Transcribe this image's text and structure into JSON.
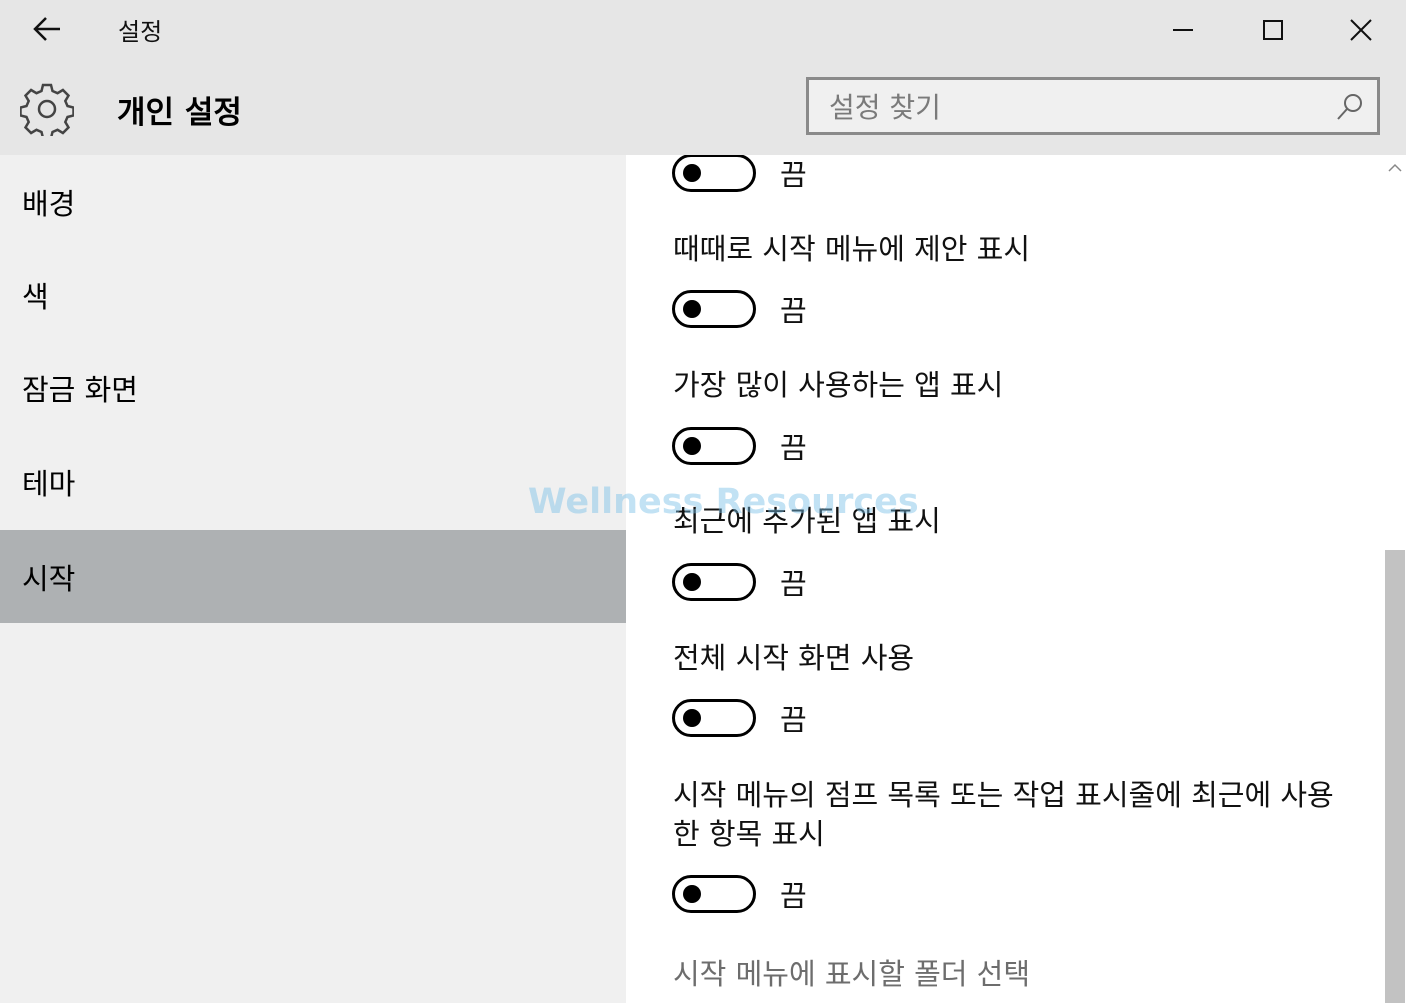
{
  "window": {
    "title": "설정",
    "controls": [
      "minimize-icon",
      "maximize-icon",
      "close-icon"
    ]
  },
  "header": {
    "icon": "gear-icon",
    "title": "개인 설정",
    "search_placeholder": "설정 찾기"
  },
  "sidebar": {
    "items": [
      {
        "label": "배경",
        "active": false
      },
      {
        "label": "색",
        "active": false
      },
      {
        "label": "잠금 화면",
        "active": false
      },
      {
        "label": "테마",
        "active": false
      },
      {
        "label": "시작",
        "active": true
      }
    ]
  },
  "settings": [
    {
      "label": "",
      "state": "끔",
      "on": false
    },
    {
      "label": "때때로 시작 메뉴에 제안 표시",
      "state": "끔",
      "on": false
    },
    {
      "label": "가장 많이 사용하는 앱 표시",
      "state": "끔",
      "on": false
    },
    {
      "label": "최근에 추가된 앱 표시",
      "state": "끔",
      "on": false
    },
    {
      "label": "전체 시작 화면 사용",
      "state": "끔",
      "on": false
    },
    {
      "label": "시작 메뉴의 점프 목록 또는 작업 표시줄에 최근에 사용한 항목 표시",
      "state": "끔",
      "on": false
    }
  ],
  "folder_link": "시작 메뉴에 표시할 폴더 선택",
  "watermark": "Wellness Resources",
  "colors": {
    "background": "#e6e6e6",
    "sidebar": "#f0f0f0",
    "sidebar_active": "#aeb1b3",
    "content": "#ffffff",
    "link": "#6d6d6d"
  }
}
